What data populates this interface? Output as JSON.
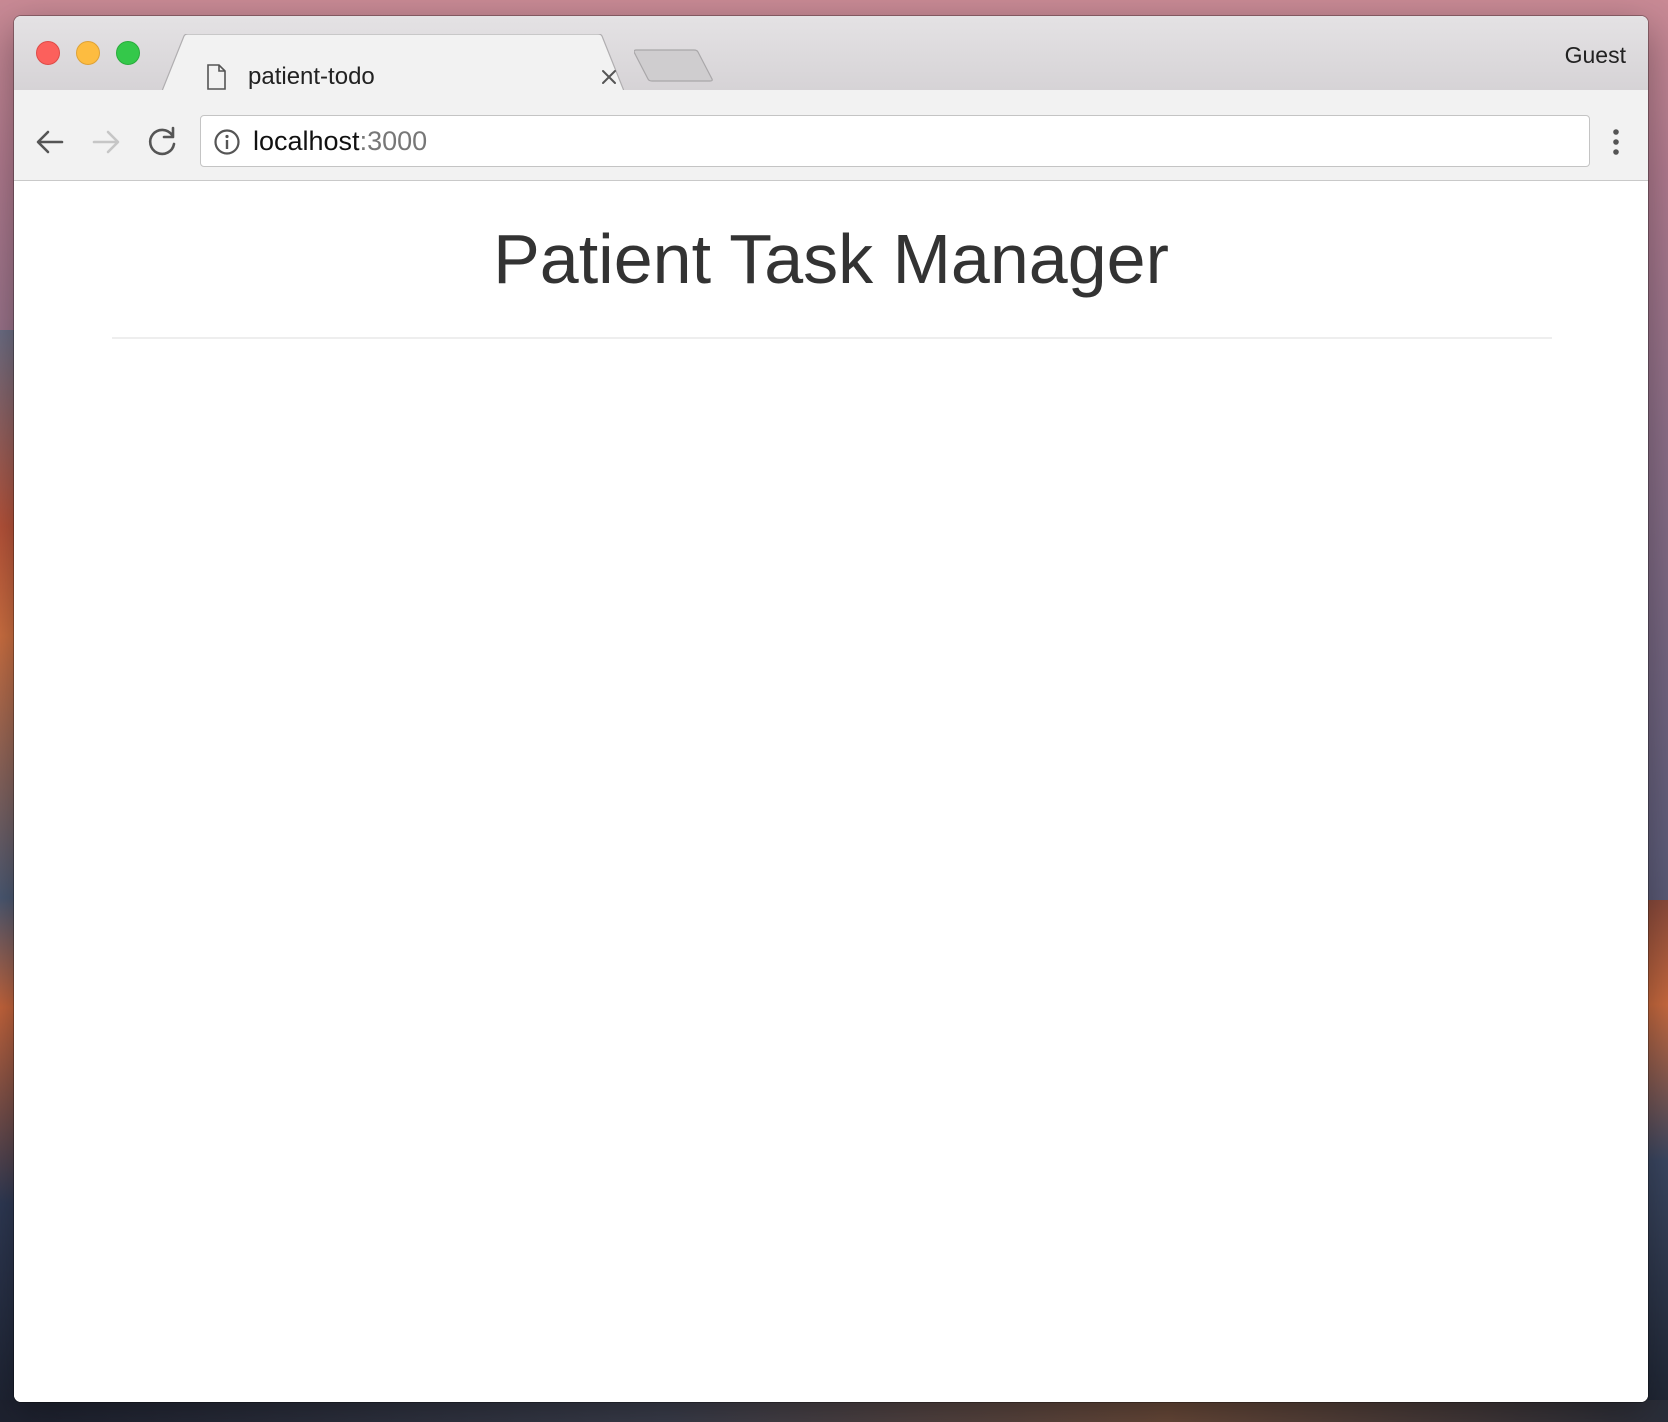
{
  "browser": {
    "tab": {
      "title": "patient-todo",
      "icon": "document-icon"
    },
    "profile_label": "Guest",
    "address_bar": {
      "host": "localhost",
      "port": ":3000"
    },
    "colors": {
      "close": "#fc605c",
      "minimize": "#fdbc40",
      "maximize": "#34c84a"
    }
  },
  "page": {
    "title": "Patient Task Manager"
  }
}
